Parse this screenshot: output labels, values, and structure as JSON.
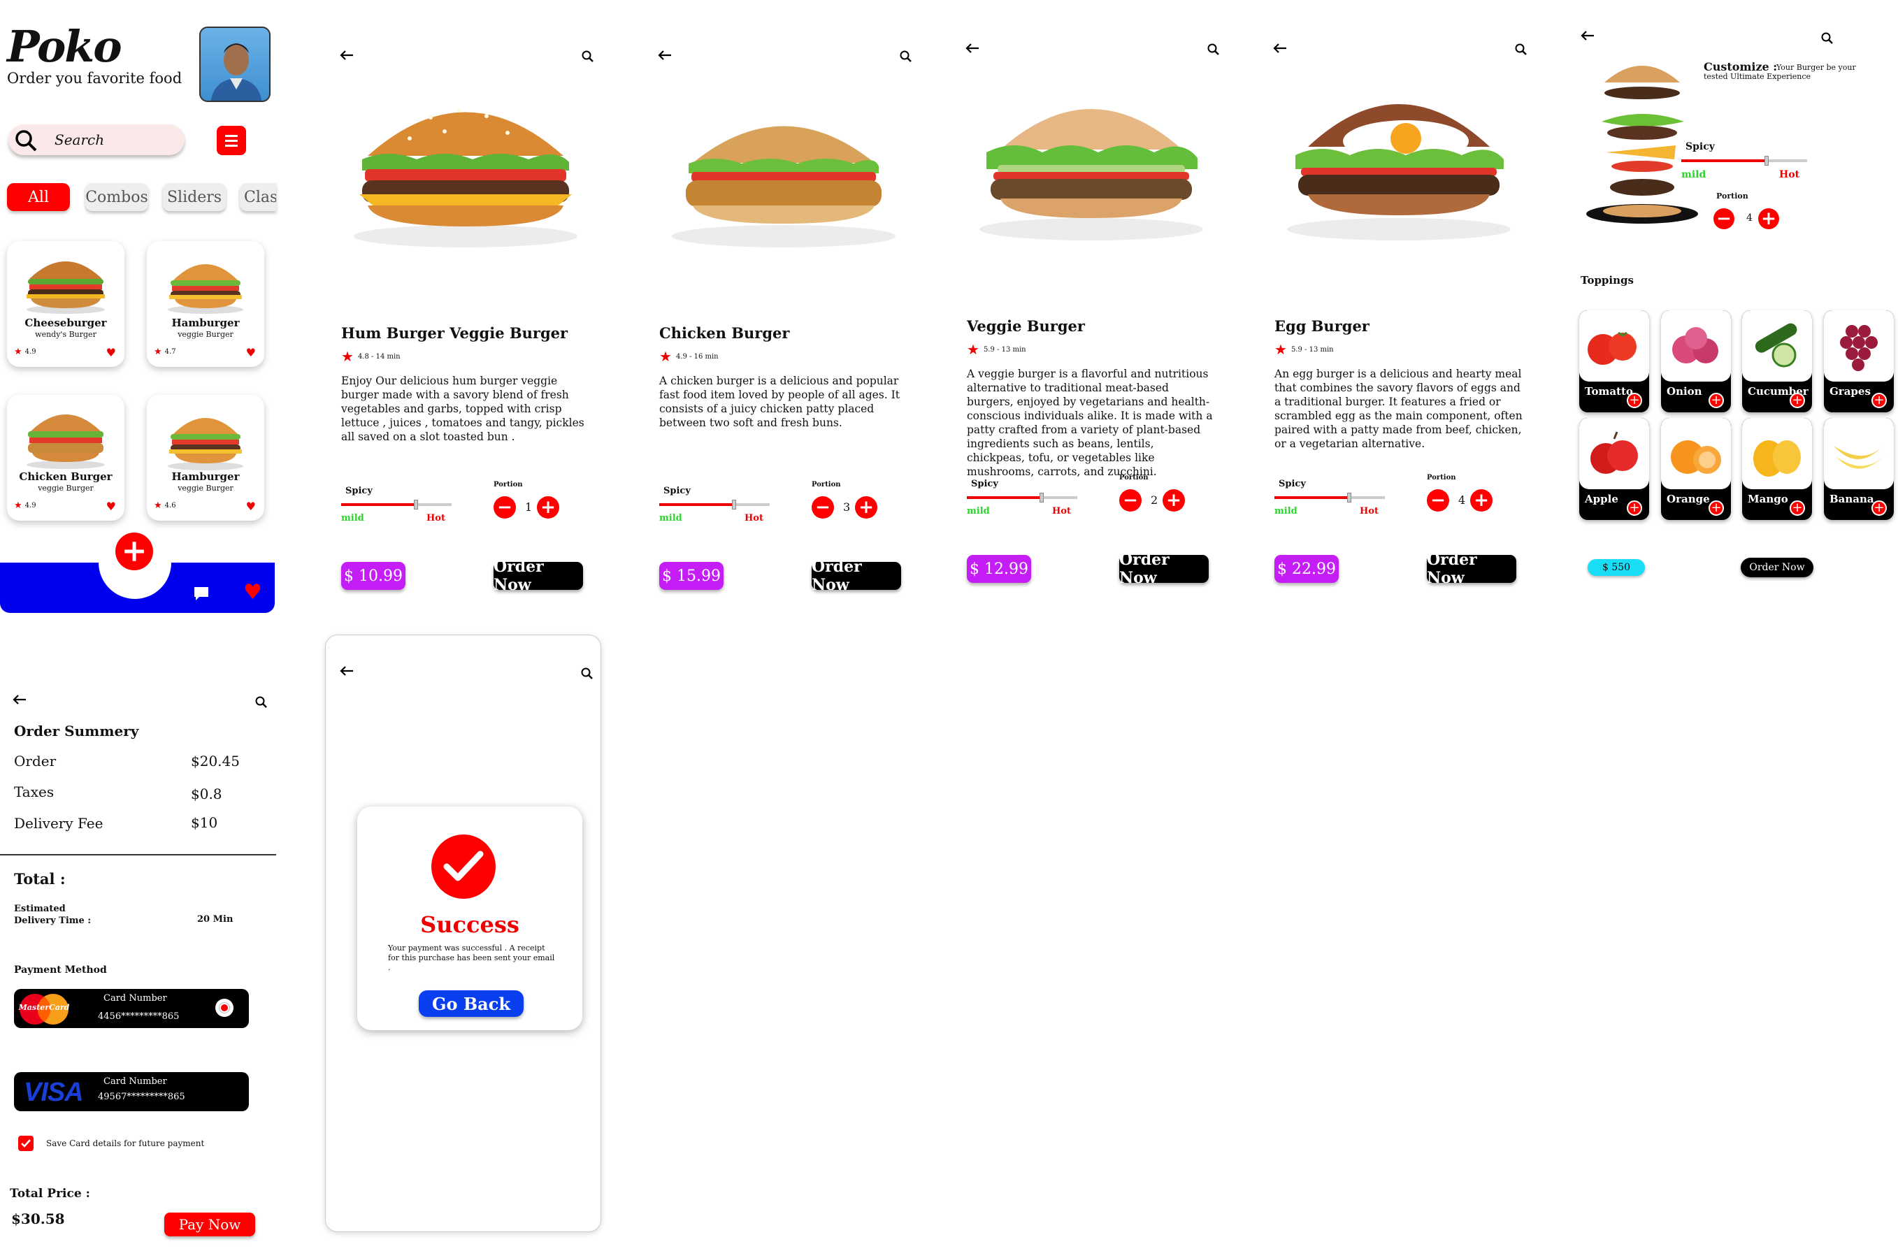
{
  "home": {
    "brand": "Poko",
    "tagline": "Order you favorite food",
    "search_placeholder": "Search",
    "categories": [
      "All",
      "Combos",
      "Sliders",
      "Class"
    ],
    "items": [
      {
        "name": "Cheeseburger",
        "sub": "wendy's  Burger",
        "rating": "4.9"
      },
      {
        "name": "Hamburger",
        "sub": "veggie Burger",
        "rating": "4.7"
      },
      {
        "name": "Chicken Burger",
        "sub": "veggie Burger",
        "rating": "4.9"
      },
      {
        "name": "Hamburger",
        "sub": "veggie Burger",
        "rating": "4.6"
      }
    ]
  },
  "details": [
    {
      "title": "Hum Burger Veggie Burger",
      "meta": "4.8 - 14 min",
      "desc": "Enjoy Our delicious hum burger veggie burger made with a savory blend of fresh vegetables and garbs,  topped with crisp lettuce , juices , tomatoes  and tangy, pickles all saved on a slot toasted bun .",
      "portion": "1",
      "price": "$ 10.99",
      "spicy_level": 0.68
    },
    {
      "title": "Chicken Burger",
      "meta": "4.9 - 16 min",
      "desc": "A chicken burger is a delicious and popular fast food item loved by people of all ages. It consists of a juicy chicken patty placed between two soft and fresh buns.",
      "portion": "3",
      "price": "$ 15.99",
      "spicy_level": 0.68
    },
    {
      "title": "Veggie Burger",
      "meta": "5.9 - 13 min",
      "desc": "A veggie burger is a flavorful and nutritious alternative to traditional meat-based burgers, enjoyed by vegetarians and health-conscious individuals alike. It is made with a patty crafted from a variety of plant-based ingredients such as beans, lentils, chickpeas, tofu, or vegetables like mushrooms, carrots, and zucchini.",
      "portion": "2",
      "price": "$ 12.99",
      "spicy_level": 0.68
    },
    {
      "title": "Egg  Burger",
      "meta": "5.9 - 13 min",
      "desc": "An egg burger is a delicious and hearty meal that combines the savory flavors of eggs and a traditional burger. It features a fried or scrambled egg as the main component, often paired with a patty made from beef, chicken, or a vegetarian alternative.",
      "portion": "4",
      "price": "$ 22.99",
      "spicy_level": 0.68
    }
  ],
  "labels": {
    "spicy": "Spicy",
    "mild": "mild",
    "hot": "Hot",
    "portion": "Portion",
    "order_now": "Order Now"
  },
  "customize": {
    "title": "Customize :",
    "subtitle": "Your Burger be your tested  Ultimate Experience",
    "portion": "4",
    "toppings_title": "Toppings",
    "toppings": [
      "Tomatto",
      "Onion",
      "Cucumber",
      "Grapes",
      "Apple",
      "Orange",
      "Mango",
      "Banana"
    ],
    "price": "$ 550",
    "spicy_level": 0.68
  },
  "summary": {
    "title": "Order Summery",
    "rows": [
      {
        "label": "Order",
        "value": "$20.45"
      },
      {
        "label": "Taxes",
        "value": "$0.8"
      },
      {
        "label": "Delivery Fee",
        "value": "$10"
      }
    ],
    "total_label": "Total :",
    "estimated_label": "Estimated\nDelivery Time :",
    "estimated_value": "20 Min",
    "payment_method": "Payment Method",
    "card_label": "Card Number",
    "mastercard_number": "4456*********865",
    "visa_number": "49567*********865",
    "mastercard_brand": "MasterCard",
    "visa_brand": "VISA",
    "save_card": "Save Card details for future payment",
    "total_price_label": "Total Price :",
    "total_price": "$30.58",
    "pay_now": "Pay Now"
  },
  "success": {
    "title": "Success",
    "message": "Your payment was successful  . A receipt for this purchase has been sent your email .",
    "button": "Go Back"
  },
  "colors": {
    "accent": "#ff0000",
    "price": "#c51df5",
    "nav_blue": "#0000ee",
    "go_back": "#0a3ff0",
    "custom_price": "#19dcf5"
  }
}
